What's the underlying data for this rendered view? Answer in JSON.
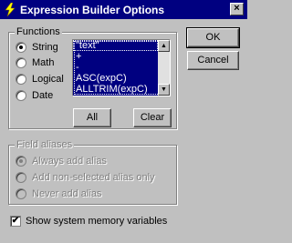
{
  "window": {
    "title": "Expression Builder Options",
    "close_glyph": "×"
  },
  "functions": {
    "label": "Functions",
    "options": [
      {
        "label": "String",
        "checked": true
      },
      {
        "label": "Math",
        "checked": false
      },
      {
        "label": "Logical",
        "checked": false
      },
      {
        "label": "Date",
        "checked": false
      }
    ],
    "list_items": [
      "\"text\"",
      "+",
      "-",
      "ASC(expC)",
      "ALLTRIM(expC)"
    ],
    "all_label": "All",
    "clear_label": "Clear"
  },
  "buttons": {
    "ok_label": "OK",
    "cancel_label": "Cancel"
  },
  "field_aliases": {
    "label": "Field aliases",
    "options": [
      {
        "label": "Always add alias",
        "checked": true
      },
      {
        "label": "Add non-selected alias only",
        "checked": false
      },
      {
        "label": "Never add alias",
        "checked": false
      }
    ]
  },
  "system_memory": {
    "label": "Show system memory variables",
    "checked": true,
    "check_glyph": "✔"
  },
  "icons": {
    "title": "lightning-icon",
    "scroll_up": "arrow-up-icon",
    "scroll_down": "arrow-down-icon"
  },
  "colors": {
    "titlebar": "#000080",
    "list_bg": "#000080",
    "face": "#c0c0c0"
  }
}
